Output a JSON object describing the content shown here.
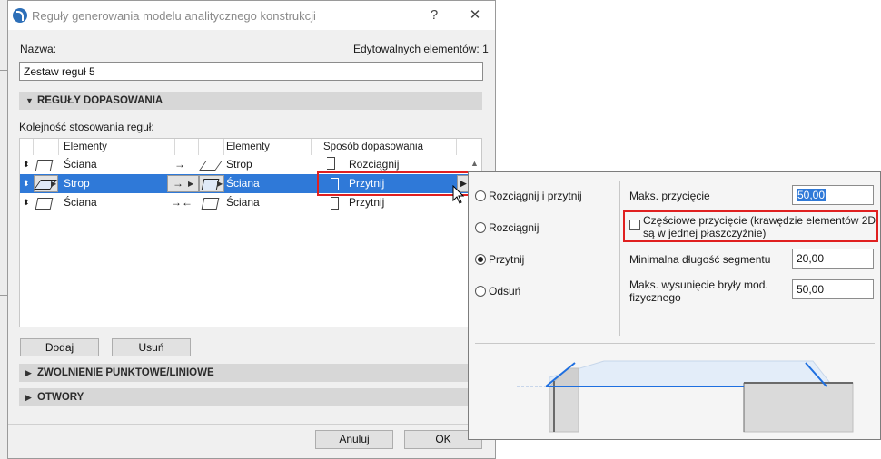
{
  "window": {
    "title": "Reguły generowania modelu analitycznego konstrukcji",
    "help_label": "?",
    "close_label": "✕"
  },
  "form": {
    "name_label": "Nazwa:",
    "editable_label": "Edytowalnych elementów: 1",
    "name_value": "Zestaw reguł 5"
  },
  "sections": {
    "rules": "REGUŁY DOPASOWANIA",
    "release": "ZWOLNIENIE PUNKTOWE/LINIOWE",
    "openings": "OTWORY"
  },
  "rules": {
    "order_label": "Kolejność stosowania reguł:",
    "columns": [
      "Elementy",
      "Elementy",
      "Sposób dopasowania"
    ],
    "rows": [
      {
        "elem1": "Ściana",
        "arrow": "→",
        "elem2": "Strop",
        "method": "Rozciągnij"
      },
      {
        "elem1": "Strop",
        "arrow": "→",
        "elem2": "Ściana",
        "method": "Przytnij"
      },
      {
        "elem1": "Ściana",
        "arrow": "→←",
        "elem2": "Ściana",
        "method": "Przytnij"
      }
    ]
  },
  "buttons": {
    "add": "Dodaj",
    "remove": "Usuń",
    "cancel": "Anuluj",
    "ok": "OK"
  },
  "popup": {
    "options": [
      "Rozciągnij i przytnij",
      "Rozciągnij",
      "Przytnij",
      "Odsuń"
    ],
    "selected_option": "Przytnij",
    "max_trim_label": "Maks. przycięcie",
    "max_trim_value": "50,00",
    "partial_trim_label": "Częściowe przycięcie (krawędzie elementów 2D są w jednej płaszczyźnie)",
    "partial_trim_checked": false,
    "min_segment_label": "Minimalna długość segmentu",
    "min_segment_value": "20,00",
    "max_offset_label": "Maks. wysunięcie bryły mod. fizycznego",
    "max_offset_value": "50,00"
  },
  "colors": {
    "selection": "#2f79d8",
    "highlight_box": "#e02020",
    "preview_line": "#1e6fe0"
  }
}
